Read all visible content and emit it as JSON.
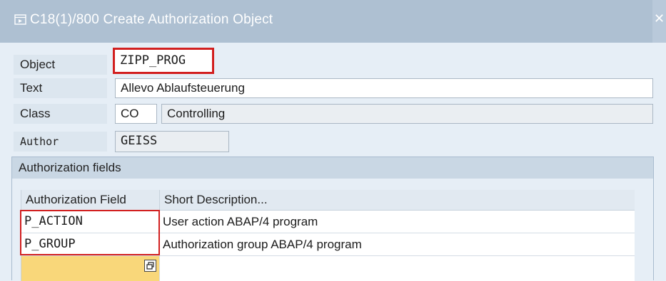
{
  "window": {
    "title": "C18(1)/800 Create Authorization Object",
    "close_glyph": "✕"
  },
  "form": {
    "object": {
      "label": "Object",
      "value": "ZIPP_PROG"
    },
    "text": {
      "label": "Text",
      "value": "Allevo Ablaufsteuerung"
    },
    "class": {
      "label": "Class",
      "code": "CO",
      "description": "Controlling"
    },
    "author": {
      "label": "Author",
      "value": "GEISS"
    }
  },
  "auth_fields": {
    "title": "Authorization fields",
    "columns": [
      "Authorization Field",
      "Short Description..."
    ],
    "rows": [
      {
        "field": "P_ACTION",
        "description": "User action ABAP/4 program"
      },
      {
        "field": "P_GROUP",
        "description": "Authorization group ABAP/4 program"
      }
    ]
  },
  "colors": {
    "titlebar": "#aec0d2",
    "highlight": "#d21f1f",
    "new_row": "#f9d77a"
  }
}
